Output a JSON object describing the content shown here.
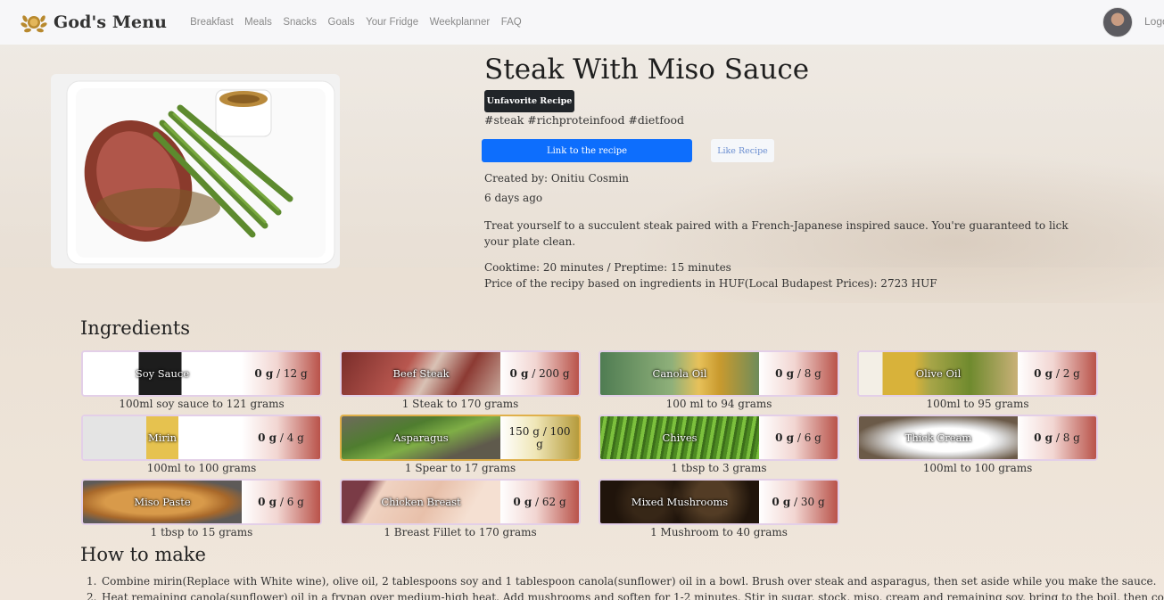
{
  "navbar": {
    "brand": "God's Menu",
    "links": [
      "Breakfast",
      "Meals",
      "Snacks",
      "Goals",
      "Your Fridge",
      "Weekplanner",
      "FAQ"
    ],
    "logout": "Logo"
  },
  "recipe": {
    "title": "Steak With Miso Sauce",
    "unfavorite_label": "Unfavorite Recipe",
    "tags": "#steak #richproteinfood #dietfood",
    "link_label": "Link to the recipe",
    "like_label": "Like Recipe",
    "created_by": "Created by: Onitiu Cosmin",
    "created_ago": "6 days ago",
    "description": "Treat yourself to a succulent steak paired with a French-Japanese inspired sauce. You're guaranteed to lick your plate clean.",
    "times": "Cooktime: 20 minutes / Preptime: 15 minutes",
    "price": "Price of the recipy based on ingredients in HUF(Local Budapest Prices): 2723 HUF"
  },
  "ingredients_heading": "Ingredients",
  "ingredients": [
    {
      "name": "Soy Sauce",
      "have": "0 g",
      "need": " / 12 g",
      "conversion": "100ml soy sauce to 121 grams"
    },
    {
      "name": "Beef Steak",
      "have": "0 g",
      "need": " / 200 g",
      "conversion": "1 Steak to 170 grams"
    },
    {
      "name": "Canola Oil",
      "have": "0 g",
      "need": " / 8 g",
      "conversion": "100 ml to 94 grams"
    },
    {
      "name": "Olive Oil",
      "have": "0 g",
      "need": " / 2 g",
      "conversion": "100ml to 95 grams"
    },
    {
      "name": "Mirin",
      "have": "0 g",
      "need": " / 4 g",
      "conversion": "100ml to 100 grams"
    },
    {
      "name": "Asparagus",
      "have": "150 g / 100 g",
      "need": "",
      "conversion": "1 Spear to 17 grams"
    },
    {
      "name": "Chives",
      "have": "0 g",
      "need": " / 6 g",
      "conversion": "1 tbsp to 3 grams"
    },
    {
      "name": "Thick Cream",
      "have": "0 g",
      "need": " / 8 g",
      "conversion": "100ml to 100 grams"
    },
    {
      "name": "Miso Paste",
      "have": "0 g",
      "need": " / 6 g",
      "conversion": "1 tbsp to 15 grams"
    },
    {
      "name": "Chicken Breast",
      "have": "0 g",
      "need": " / 62 g",
      "conversion": "1 Breast Fillet to 170 grams"
    },
    {
      "name": "Mixed Mushrooms",
      "have": "0 g",
      "need": " / 30 g",
      "conversion": "1 Mushroom to 40 grams"
    }
  ],
  "how_heading": "How to make",
  "steps": [
    "Combine mirin(Replace with White wine), olive oil, 2 tablespoons soy and 1 tablespoon canola(sunflower) oil in a bowl. Brush over steak and asparagus, then set aside while you make the sauce.",
    "Heat remaining canola(sunflower) oil in a frypan over medium-high heat. Add mushrooms and soften for 1-2 minutes. Stir in sugar, stock, miso, cream and remaining soy, bring to the boil, then cook"
  ],
  "colors": {
    "primary": "#0d6efd",
    "dark": "#212529",
    "card_border": "#e3cfe8",
    "card_full_border": "#e0b04a"
  }
}
